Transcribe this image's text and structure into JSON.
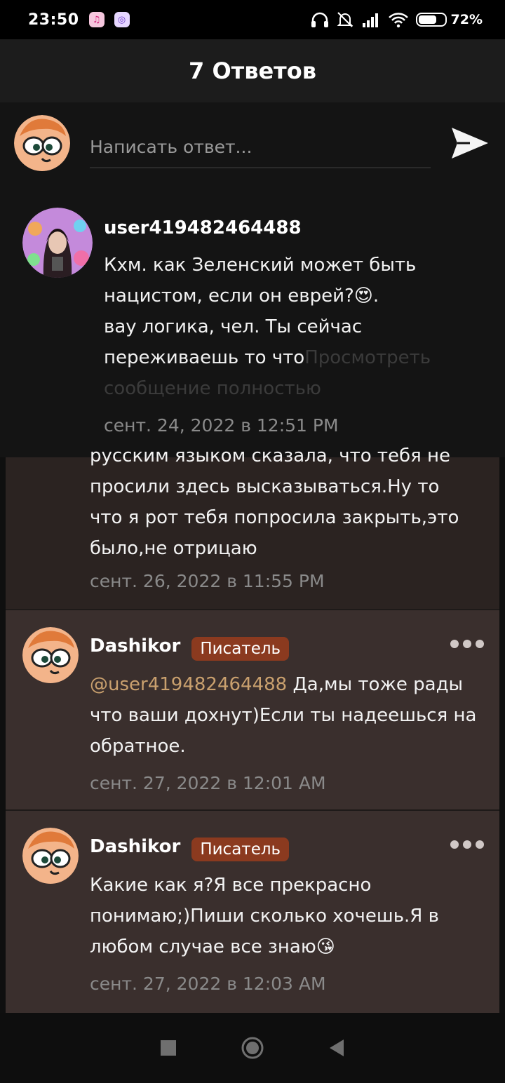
{
  "status_bar": {
    "time": "23:50",
    "battery_percent": "72%",
    "battery_level": 0.72,
    "icons": [
      "music-app-icon",
      "app-icon",
      "headphones-icon",
      "muted-bell-icon",
      "signal-icon",
      "wifi-icon",
      "battery-icon"
    ]
  },
  "header": {
    "title": "7 Ответов"
  },
  "reply": {
    "placeholder": "Написать ответ...",
    "send_icon": "send-icon"
  },
  "overlay_comment": {
    "username": "user419482464488",
    "text_lines": [
      "Кхм. как Зеленский может быть",
      "нацистом, если он еврей?",
      ".",
      "вау логика, чел. Ты сейчас",
      "переживаешь то что"
    ],
    "emoji": "😍",
    "more_link": "Просмотреть сообщение полностью",
    "timestamp": "сент. 24, 2022 в 12:51 PM"
  },
  "comments": [
    {
      "partial": true,
      "text_lines": [
        "русским языком сказала, что тебя не",
        "просили здесь высказываться.Ну то",
        "что я рот тебя попросила закрыть,это",
        "было,не отрицаю"
      ],
      "timestamp": "сент. 26, 2022 в 11:55 PM"
    },
    {
      "username": "Dashikor",
      "badge": "Писатель",
      "mention": "@user419482464488",
      "text_first": " Да,мы тоже рады",
      "text_lines": [
        "что ваши дохнут)Если ты надеешься на",
        "обратное."
      ],
      "timestamp": "сент. 27, 2022 в 12:01 AM"
    },
    {
      "username": "Dashikor",
      "badge": "Писатель",
      "text_lines": [
        "Какие как я?Я все прекрасно",
        "понимаю;)Пиши сколько хочешь.Я в",
        "любом случае все знаю"
      ],
      "emoji": "😘",
      "timestamp": "сент. 27, 2022 в 12:03 AM"
    }
  ],
  "nav": {
    "icons": [
      "square-recents-icon",
      "circle-home-icon",
      "triangle-back-icon"
    ]
  },
  "colors": {
    "badge": "#8b3a1f",
    "mention": "#c9a06e",
    "card_bg": "#3a2f2d"
  }
}
